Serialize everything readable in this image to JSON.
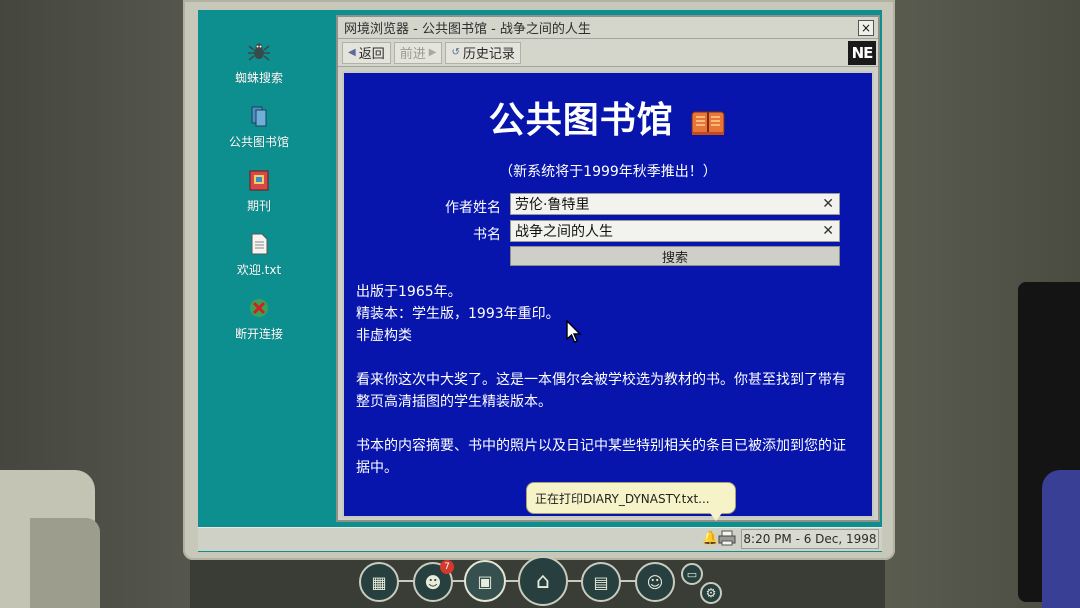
{
  "desktop": {
    "icons": [
      {
        "label": "蜘蛛搜索",
        "icon": "spider-icon"
      },
      {
        "label": "公共图书馆",
        "icon": "library-books-icon"
      },
      {
        "label": "期刊",
        "icon": "journal-icon"
      },
      {
        "label": "欢迎.txt",
        "icon": "text-file-icon"
      },
      {
        "label": "断开连接",
        "icon": "disconnect-icon"
      }
    ]
  },
  "browser": {
    "title": "网境浏览器 - 公共图书馆 - 战争之间的人生",
    "close_label": "×",
    "toolbar": {
      "back_label": "返回",
      "forward_label": "前进",
      "history_label": "历史记录",
      "logo": "NE"
    }
  },
  "page": {
    "title": "公共图书馆",
    "subtitle": "（新系统将于1999年秋季推出！）",
    "author_label": "作者姓名",
    "author_value": "劳伦·鲁特里",
    "book_label": "书名",
    "book_value": "战争之间的人生",
    "clear_glyph": "✕",
    "search_label": "搜索",
    "info_lines": [
      "出版于1965年。",
      "精装本：学生版，1993年重印。",
      "非虚构类"
    ],
    "paragraph1": "看来你这次中大奖了。这是一本偶尔会被学校选为教材的书。你甚至找到了带有整页高清插图的学生精装版本。",
    "paragraph2": "书本的内容摘要、书中的照片以及日记中某些特别相关的条目已被添加到您的证据中。"
  },
  "taskbar": {
    "tooltip": "正在打印DIARY_DYNASTY.txt...",
    "clock": "8:20 PM - 6 Dec, 1998"
  },
  "dock": {
    "buttons": [
      "evidence-board-icon",
      "suspects-icon",
      "computer-icon",
      "home-icon",
      "notebook-icon",
      "contact-icon",
      "settings-icon"
    ],
    "badge_count": "7"
  },
  "colors": {
    "desktop_teal": "#0e8f8f",
    "page_blue": "#0715ac",
    "window_grey": "#cfd0c6"
  }
}
